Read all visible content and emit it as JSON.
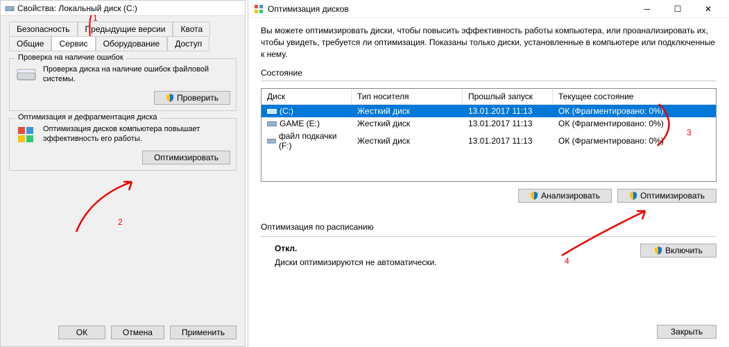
{
  "left_window": {
    "title": "Свойства: Локальный диск (C:)",
    "tabs_top": [
      "Безопасность",
      "Предыдущие версии",
      "Квота"
    ],
    "tabs_bottom": [
      "Общие",
      "Сервис",
      "Оборудование",
      "Доступ"
    ],
    "active_tab": "Сервис",
    "group1": {
      "title": "Проверка на наличие ошибок",
      "text": "Проверка диска на наличие ошибок файловой системы.",
      "button": "Проверить"
    },
    "group2": {
      "title": "Оптимизация и дефрагментация диска",
      "text": "Оптимизация дисков компьютера повышает эффективность его работы.",
      "button": "Оптимизировать"
    },
    "footer": {
      "ok": "ОК",
      "cancel": "Отмена",
      "apply": "Применить"
    }
  },
  "right_window": {
    "title": "Оптимизация дисков",
    "description": "Вы можете оптимизировать диски, чтобы повысить эффективность работы  компьютера, или проанализировать их, чтобы увидеть, требуется ли оптимизация. Показаны только диски, установленные в компьютере или подключенные к нему.",
    "state_label": "Состояние",
    "columns": {
      "c1": "Диск",
      "c2": "Тип носителя",
      "c3": "Прошлый запуск",
      "c4": "Текущее состояние"
    },
    "rows": [
      {
        "name": "(C:)",
        "type": "Жесткий диск",
        "last": "13.01.2017 11:13",
        "state": "ОК (Фрагментировано: 0%)",
        "selected": true
      },
      {
        "name": "GAME (E:)",
        "type": "Жесткий диск",
        "last": "13.01.2017 11:13",
        "state": "ОК (Фрагментировано: 0%)",
        "selected": false
      },
      {
        "name": "файл подкачки (F:)",
        "type": "Жесткий диск",
        "last": "13.01.2017 11:13",
        "state": "ОК (Фрагментировано: 0%)",
        "selected": false
      }
    ],
    "analyze_btn": "Анализировать",
    "optimize_btn": "Оптимизировать",
    "schedule": {
      "label": "Оптимизация по расписанию",
      "off": "Откл.",
      "text": "Диски оптимизируются не автоматически.",
      "enable_btn": "Включить"
    },
    "close_btn": "Закрыть"
  },
  "annotations": [
    "1",
    "2",
    "3",
    "4"
  ]
}
